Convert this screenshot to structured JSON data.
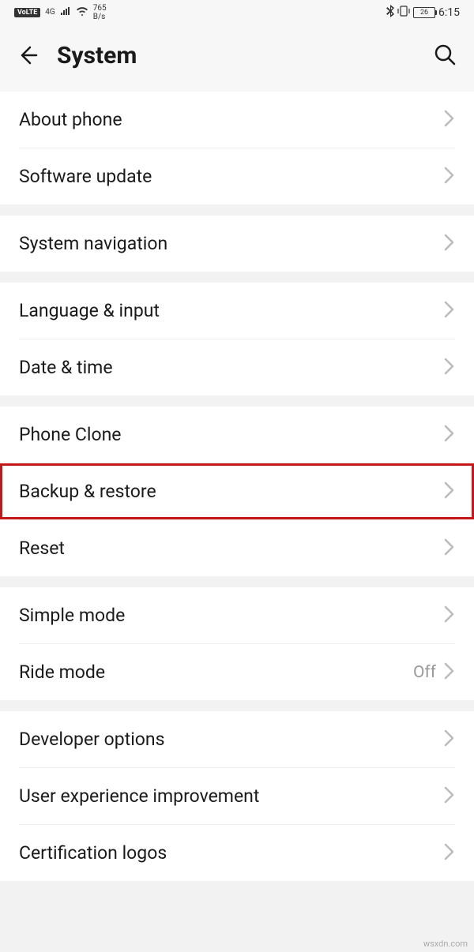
{
  "status_bar": {
    "volte": "VoLTE",
    "net_tag": "4G",
    "data_rate_top": "765",
    "data_rate_bottom": "B/s",
    "battery_pct": "26",
    "clock": "6:15"
  },
  "header": {
    "title": "System"
  },
  "groups": [
    {
      "items": [
        {
          "label": "About phone",
          "value": "",
          "highlight": false
        },
        {
          "label": "Software update",
          "value": "",
          "highlight": false
        }
      ]
    },
    {
      "items": [
        {
          "label": "System navigation",
          "value": "",
          "highlight": false
        }
      ]
    },
    {
      "items": [
        {
          "label": "Language & input",
          "value": "",
          "highlight": false
        },
        {
          "label": "Date & time",
          "value": "",
          "highlight": false
        }
      ]
    },
    {
      "items": [
        {
          "label": "Phone Clone",
          "value": "",
          "highlight": false
        },
        {
          "label": "Backup & restore",
          "value": "",
          "highlight": true
        },
        {
          "label": "Reset",
          "value": "",
          "highlight": false
        }
      ]
    },
    {
      "items": [
        {
          "label": "Simple mode",
          "value": "",
          "highlight": false
        },
        {
          "label": "Ride mode",
          "value": "Off",
          "highlight": false
        }
      ]
    },
    {
      "items": [
        {
          "label": "Developer options",
          "value": "",
          "highlight": false
        },
        {
          "label": "User experience improvement",
          "value": "",
          "highlight": false
        },
        {
          "label": "Certification logos",
          "value": "",
          "highlight": false
        }
      ]
    }
  ],
  "watermark": "wsxdn.com"
}
